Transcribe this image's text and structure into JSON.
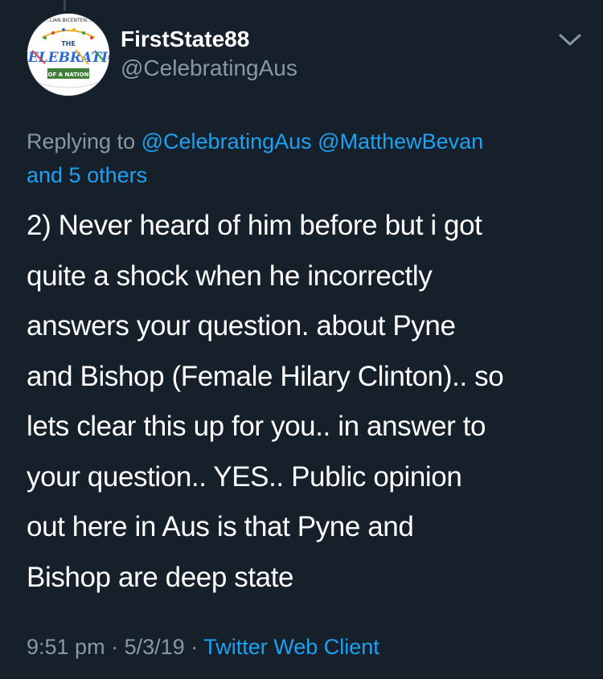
{
  "tweet": {
    "author": {
      "display_name": "FirstState88",
      "handle": "@CelebratingAus",
      "avatar_logo_text": {
        "arc": "…LIAN BICENTEN…",
        "the": "THE",
        "main": "CELEBRATIO",
        "sub": "OF A NATION"
      }
    },
    "menu_icon": "chevron-down-icon",
    "replying_to": {
      "prefix": "Replying to",
      "mention_1": "@CelebratingAus",
      "mention_2": "@MatthewBevan",
      "others": "and 5 others"
    },
    "body_lines": [
      "2) Never heard of him before but i got",
      "quite a shock when he incorrectly",
      "answers your question. about Pyne",
      "and Bishop (Female Hilary Clinton).. so",
      "lets clear this up for you.. in answer to",
      "your question.. YES.. Public opinion",
      "out here in Aus is that Pyne and",
      "Bishop are deep state"
    ],
    "time": "9:51 pm",
    "date": "5/3/19",
    "separator": "·",
    "client": "Twitter Web Client"
  },
  "colors": {
    "background": "#15202b",
    "primary_text": "#ffffff",
    "secondary_text": "#8899a6",
    "link": "#1da1f2"
  }
}
